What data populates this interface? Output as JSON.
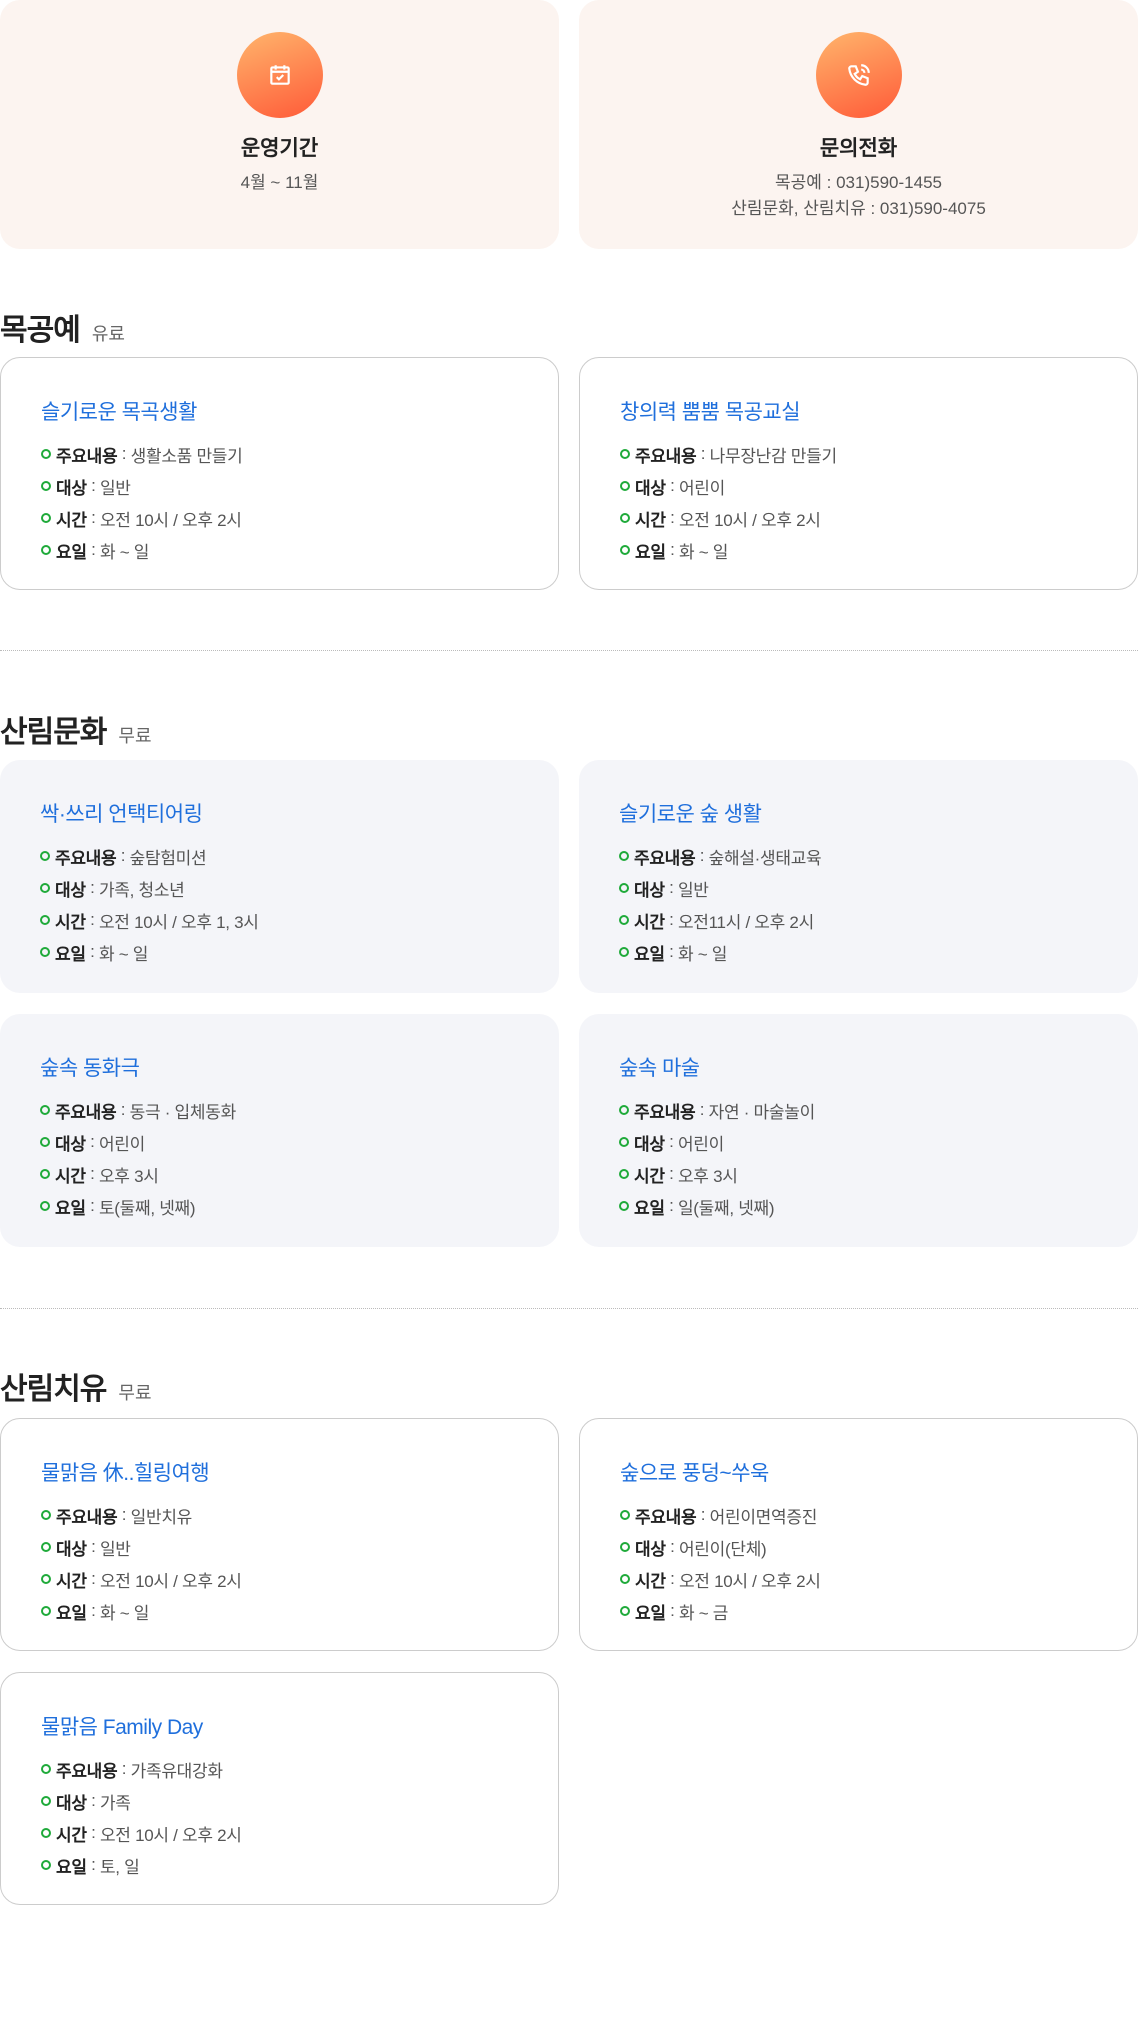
{
  "info": [
    {
      "icon": "calendar-check-icon",
      "title": "운영기간",
      "lines": [
        "4월 ~ 11월"
      ]
    },
    {
      "icon": "phone-icon",
      "title": "문의전화",
      "lines": [
        "목공예 : 031)590-1455",
        "산림문화, 산림치유 : 031)590-4075"
      ]
    }
  ],
  "labels": {
    "content": "주요내용",
    "target": "대상",
    "time": "시간",
    "day": "요일",
    "sep": " : "
  },
  "sections": [
    {
      "title": "목공예",
      "fee": "유료",
      "style": "white",
      "cards": [
        {
          "title": "슬기로운 목곡생활",
          "content": "생활소품 만들기",
          "target": "일반",
          "time": "오전 10시 / 오후 2시",
          "day": "화 ~ 일"
        },
        {
          "title": "창의력 뿜뿜 목공교실",
          "content": "나무장난감 만들기",
          "target": "어린이",
          "time": "오전 10시 / 오후 2시",
          "day": "화 ~ 일"
        }
      ]
    },
    {
      "title": "산림문화",
      "fee": "무료",
      "style": "grey",
      "cards": [
        {
          "title": "싹·쓰리 언택티어링",
          "content": "숲탐험미션",
          "target": "가족, 청소년",
          "time": "오전 10시 / 오후 1, 3시",
          "day": "화 ~ 일"
        },
        {
          "title": "슬기로운 숲 생활",
          "content": "숲해설·생태교육",
          "target": "일반",
          "time": "오전11시 / 오후 2시",
          "day": "화 ~ 일"
        },
        {
          "title": "숲속 동화극",
          "content": "동극 · 입체동화",
          "target": "어린이",
          "time": "오후 3시",
          "day": "토(둘째, 넷째)"
        },
        {
          "title": "숲속 마술",
          "content": "자연 · 마술놀이",
          "target": "어린이",
          "time": "오후 3시",
          "day": "일(둘째, 넷째)"
        }
      ]
    },
    {
      "title": "산림치유",
      "fee": "무료",
      "style": "white",
      "cards": [
        {
          "title": "물맑음 休..힐링여행",
          "content": "일반치유",
          "target": "일반",
          "time": "오전 10시 / 오후 2시",
          "day": "화 ~ 일"
        },
        {
          "title": "숲으로 풍덩~쑤욱",
          "content": "어린이면역증진",
          "target": "어린이(단체)",
          "time": "오전 10시 / 오후 2시",
          "day": "화 ~ 금"
        },
        {
          "title": "물맑음 Family Day",
          "content": "가족유대강화",
          "target": "가족",
          "time": "오전 10시 / 오후 2시",
          "day": "토, 일"
        }
      ]
    }
  ]
}
